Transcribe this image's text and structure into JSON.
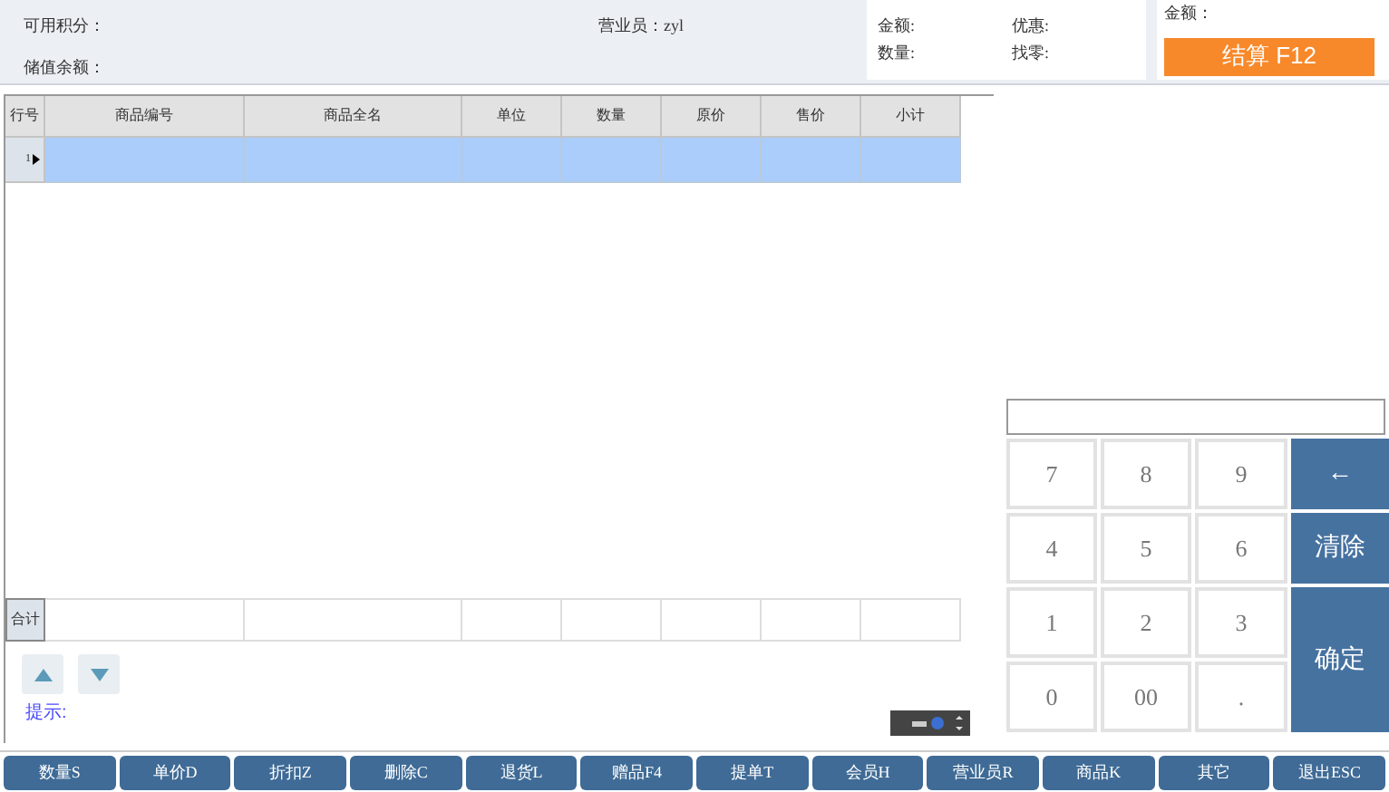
{
  "header": {
    "points_label": "可用积分：",
    "clerk": "营业员：zyl",
    "balance_label": "储值余额：",
    "summary": [
      {
        "label": "金额:"
      },
      {
        "label": "优惠:"
      },
      {
        "label": "数量:"
      },
      {
        "label": "找零:"
      }
    ],
    "amount_label": "金额：",
    "checkout_button": "结算 F12"
  },
  "table": {
    "columns": [
      "行号",
      "商品编号",
      "商品全名",
      "单位",
      "数量",
      "原价",
      "售价",
      "小计"
    ],
    "rows": [
      {
        "row_number": "1",
        "selected": true
      }
    ],
    "total_label": "合计"
  },
  "hint_label": "提示:",
  "keypad": {
    "keys": [
      {
        "label": "7",
        "kind": "digit"
      },
      {
        "label": "8",
        "kind": "digit"
      },
      {
        "label": "9",
        "kind": "digit"
      },
      {
        "label": "←",
        "kind": "action"
      },
      {
        "label": "4",
        "kind": "digit"
      },
      {
        "label": "5",
        "kind": "digit"
      },
      {
        "label": "6",
        "kind": "digit"
      },
      {
        "label": "清除",
        "kind": "action"
      },
      {
        "label": "1",
        "kind": "digit"
      },
      {
        "label": "2",
        "kind": "digit"
      },
      {
        "label": "3",
        "kind": "digit"
      },
      {
        "label": "确定",
        "kind": "tall"
      },
      {
        "label": "0",
        "kind": "digit"
      },
      {
        "label": "00",
        "kind": "digit"
      },
      {
        "label": ".",
        "kind": "digit"
      }
    ]
  },
  "function_buttons": [
    "数量S",
    "单价D",
    "折扣Z",
    "删除C",
    "退货L",
    "赠品F4",
    "提单T",
    "会员H",
    "营业员R",
    "商品K",
    "其它",
    "退出ESC"
  ]
}
